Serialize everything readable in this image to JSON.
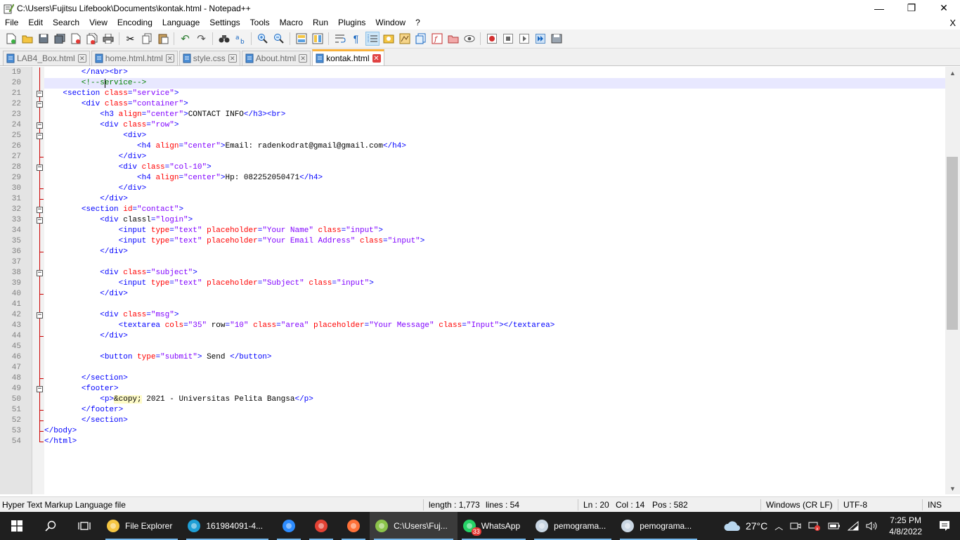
{
  "window": {
    "title": "C:\\Users\\Fujitsu Lifebook\\Documents\\kontak.html - Notepad++",
    "minimize": "—",
    "maximize": "❐",
    "close": "✕"
  },
  "menu": {
    "items": [
      "File",
      "Edit",
      "Search",
      "View",
      "Encoding",
      "Language",
      "Settings",
      "Tools",
      "Macro",
      "Run",
      "Plugins",
      "Window",
      "?"
    ],
    "close_doc": "X"
  },
  "tabs": [
    {
      "label": "LAB4_Box.html",
      "active": false
    },
    {
      "label": "home.html.html",
      "active": false
    },
    {
      "label": "style.css",
      "active": false
    },
    {
      "label": "About.html",
      "active": false
    },
    {
      "label": "kontak.html",
      "active": true
    }
  ],
  "editor": {
    "first_line": 19,
    "current_line": 20,
    "lines": [
      {
        "n": "19",
        "fold": "line",
        "html": "<span class='tg'>        &lt;/nav&gt;&lt;br&gt;</span>"
      },
      {
        "n": "20",
        "fold": "line",
        "html": "<span class='cm'>        &lt;!--service--&gt;</span>"
      },
      {
        "n": "21",
        "fold": "box",
        "html": "    <span class='tg'>&lt;section</span> <span class='at'>class</span><span class='tg'>=</span><span class='vl'>\"service\"</span><span class='tg'>&gt;</span>"
      },
      {
        "n": "22",
        "fold": "box",
        "html": "        <span class='tg'>&lt;div</span> <span class='at'>class</span><span class='tg'>=</span><span class='vl'>\"container\"</span><span class='tg'>&gt;</span>"
      },
      {
        "n": "23",
        "fold": "line",
        "html": "            <span class='tg'>&lt;h3</span> <span class='at'>align</span><span class='tg'>=</span><span class='vl'>\"center\"</span><span class='tg'>&gt;</span><span class='tx'>CONTACT INFO</span><span class='tg'>&lt;/h3&gt;&lt;br&gt;</span>"
      },
      {
        "n": "24",
        "fold": "box",
        "html": "            <span class='tg'>&lt;div</span> <span class='at'>class</span><span class='tg'>=</span><span class='vl'>\"row\"</span><span class='tg'>&gt;</span>"
      },
      {
        "n": "25",
        "fold": "box",
        "html": "                 <span class='tg'>&lt;div&gt;</span>"
      },
      {
        "n": "26",
        "fold": "line",
        "html": "                    <span class='tg'>&lt;h4</span> <span class='at'>align</span><span class='tg'>=</span><span class='vl'>\"center\"</span><span class='tg'>&gt;</span><span class='tx'>Email: radenkodrat@gmail@gmail.com</span><span class='tg'>&lt;/h4&gt;</span>"
      },
      {
        "n": "27",
        "fold": "end",
        "html": "                <span class='tg'>&lt;/div&gt;</span>"
      },
      {
        "n": "28",
        "fold": "box",
        "html": "                <span class='tg'>&lt;div</span> <span class='at'>class</span><span class='tg'>=</span><span class='vl'>\"col-10\"</span><span class='tg'>&gt;</span>"
      },
      {
        "n": "29",
        "fold": "line",
        "html": "                    <span class='tg'>&lt;h4</span> <span class='at'>align</span><span class='tg'>=</span><span class='vl'>\"center\"</span><span class='tg'>&gt;</span><span class='tx'>Hp: 082252050471</span><span class='tg'>&lt;/h4&gt;</span>"
      },
      {
        "n": "30",
        "fold": "end",
        "html": "                <span class='tg'>&lt;/div&gt;</span>"
      },
      {
        "n": "31",
        "fold": "end",
        "html": "            <span class='tg'>&lt;/div&gt;</span>"
      },
      {
        "n": "32",
        "fold": "box",
        "html": "        <span class='tg'>&lt;section</span> <span class='at'>id</span><span class='tg'>=</span><span class='vl'>\"contact\"</span><span class='tg'>&gt;</span>"
      },
      {
        "n": "33",
        "fold": "box",
        "html": "            <span class='tg'>&lt;div</span> <span class='tx'>classl</span><span class='tg'>=</span><span class='vl'>\"login\"</span><span class='tg'>&gt;</span>"
      },
      {
        "n": "34",
        "fold": "line",
        "html": "                <span class='tg'>&lt;input</span> <span class='at'>type</span><span class='tg'>=</span><span class='vl'>\"text\"</span> <span class='at'>placeholder</span><span class='tg'>=</span><span class='vl'>\"Your Name\"</span> <span class='at'>class</span><span class='tg'>=</span><span class='vl'>\"input\"</span><span class='tg'>&gt;</span>"
      },
      {
        "n": "35",
        "fold": "line",
        "html": "                <span class='tg'>&lt;input</span> <span class='at'>type</span><span class='tg'>=</span><span class='vl'>\"text\"</span> <span class='at'>placeholder</span><span class='tg'>=</span><span class='vl'>\"Your Email Address\"</span> <span class='at'>class</span><span class='tg'>=</span><span class='vl'>\"input\"</span><span class='tg'>&gt;</span>"
      },
      {
        "n": "36",
        "fold": "end",
        "html": "            <span class='tg'>&lt;/div&gt;</span>"
      },
      {
        "n": "37",
        "fold": "line",
        "html": ""
      },
      {
        "n": "38",
        "fold": "box",
        "html": "            <span class='tg'>&lt;div</span> <span class='at'>class</span><span class='tg'>=</span><span class='vl'>\"subject\"</span><span class='tg'>&gt;</span>"
      },
      {
        "n": "39",
        "fold": "line",
        "html": "                <span class='tg'>&lt;input</span> <span class='at'>type</span><span class='tg'>=</span><span class='vl'>\"text\"</span> <span class='at'>placeholder</span><span class='tg'>=</span><span class='vl'>\"Subject\"</span> <span class='at'>class</span><span class='tg'>=</span><span class='vl'>\"input\"</span><span class='tg'>&gt;</span>"
      },
      {
        "n": "40",
        "fold": "end",
        "html": "            <span class='tg'>&lt;/div&gt;</span>"
      },
      {
        "n": "41",
        "fold": "line",
        "html": ""
      },
      {
        "n": "42",
        "fold": "box",
        "html": "            <span class='tg'>&lt;div</span> <span class='at'>class</span><span class='tg'>=</span><span class='vl'>\"msg\"</span><span class='tg'>&gt;</span>"
      },
      {
        "n": "43",
        "fold": "line",
        "html": "                <span class='tg'>&lt;textarea</span> <span class='at'>cols</span><span class='tg'>=</span><span class='vl'>\"35\"</span> <span class='tx'>row</span><span class='tg'>=</span><span class='vl'>\"10\"</span> <span class='at'>class</span><span class='tg'>=</span><span class='vl'>\"area\"</span> <span class='at'>placeholder</span><span class='tg'>=</span><span class='vl'>\"Your Message\"</span> <span class='at'>class</span><span class='tg'>=</span><span class='vl'>\"Input\"</span><span class='tg'>&gt;&lt;/textarea&gt;</span>"
      },
      {
        "n": "44",
        "fold": "end",
        "html": "            <span class='tg'>&lt;/div&gt;</span>"
      },
      {
        "n": "45",
        "fold": "line",
        "html": ""
      },
      {
        "n": "46",
        "fold": "line",
        "html": "            <span class='tg'>&lt;button</span> <span class='at'>type</span><span class='tg'>=</span><span class='vl'>\"submit\"</span><span class='tg'>&gt;</span><span class='tx'> Send </span><span class='tg'>&lt;/button&gt;</span>"
      },
      {
        "n": "47",
        "fold": "line",
        "html": ""
      },
      {
        "n": "48",
        "fold": "end",
        "html": "        <span class='tg'>&lt;/section&gt;</span>"
      },
      {
        "n": "49",
        "fold": "box",
        "html": "        <span class='tg'>&lt;footer&gt;</span>"
      },
      {
        "n": "50",
        "fold": "line",
        "html": "            <span class='tg'>&lt;p&gt;</span><span class='en'>&amp;copy;</span><span class='tx'> 2021 - Universitas Pelita Bangsa</span><span class='tg'>&lt;/p&gt;</span>"
      },
      {
        "n": "51",
        "fold": "end",
        "html": "        <span class='tg'>&lt;/footer&gt;</span>"
      },
      {
        "n": "52",
        "fold": "end",
        "html": "        <span class='tg'>&lt;/section&gt;</span>"
      },
      {
        "n": "53",
        "fold": "end",
        "html": "<span class='tg'>&lt;/body&gt;</span>"
      },
      {
        "n": "54",
        "fold": "end",
        "html": "<span class='tg'>&lt;/html&gt;</span>"
      }
    ]
  },
  "status": {
    "file_type": "Hyper Text Markup Language file",
    "length": "length : 1,773",
    "lines": "lines : 54",
    "ln": "Ln : 20",
    "col": "Col : 14",
    "pos": "Pos : 582",
    "eol": "Windows (CR LF)",
    "encoding": "UTF-8",
    "mode": "INS"
  },
  "taskbar": {
    "apps": [
      {
        "label": "File Explorer",
        "icon": "folder-icon",
        "color": "#f4c542",
        "active": false,
        "open": true
      },
      {
        "label": "161984091-4...",
        "icon": "edge-icon",
        "color": "#1f9fd6",
        "active": false,
        "open": true
      },
      {
        "label": "",
        "icon": "zoom-icon",
        "color": "#2d8cff",
        "active": false,
        "open": true
      },
      {
        "label": "",
        "icon": "chrome-icon",
        "color": "#e34133",
        "active": false,
        "open": true
      },
      {
        "label": "",
        "icon": "firefox-icon",
        "color": "#ff7139",
        "active": false,
        "open": true
      },
      {
        "label": "C:\\Users\\Fuj...",
        "icon": "notepadpp-icon",
        "color": "#8bc34a",
        "active": true,
        "open": true
      },
      {
        "label": "WhatsApp",
        "icon": "whatsapp-icon",
        "color": "#25d366",
        "badge": "33",
        "active": false,
        "open": true
      },
      {
        "label": "pemograma...",
        "icon": "paint-icon",
        "color": "#c9d6e3",
        "active": false,
        "open": true
      },
      {
        "label": "pemograma...",
        "icon": "paint-icon",
        "color": "#c9d6e3",
        "active": false,
        "open": true
      }
    ],
    "weather": "27°C",
    "time": "7:25 PM",
    "date": "4/8/2022"
  },
  "colors": {
    "tag": "#0000ff",
    "attribute": "#ff0000",
    "value": "#8000ff",
    "comment": "#008000",
    "active_tab_accent": "#fab23a"
  }
}
